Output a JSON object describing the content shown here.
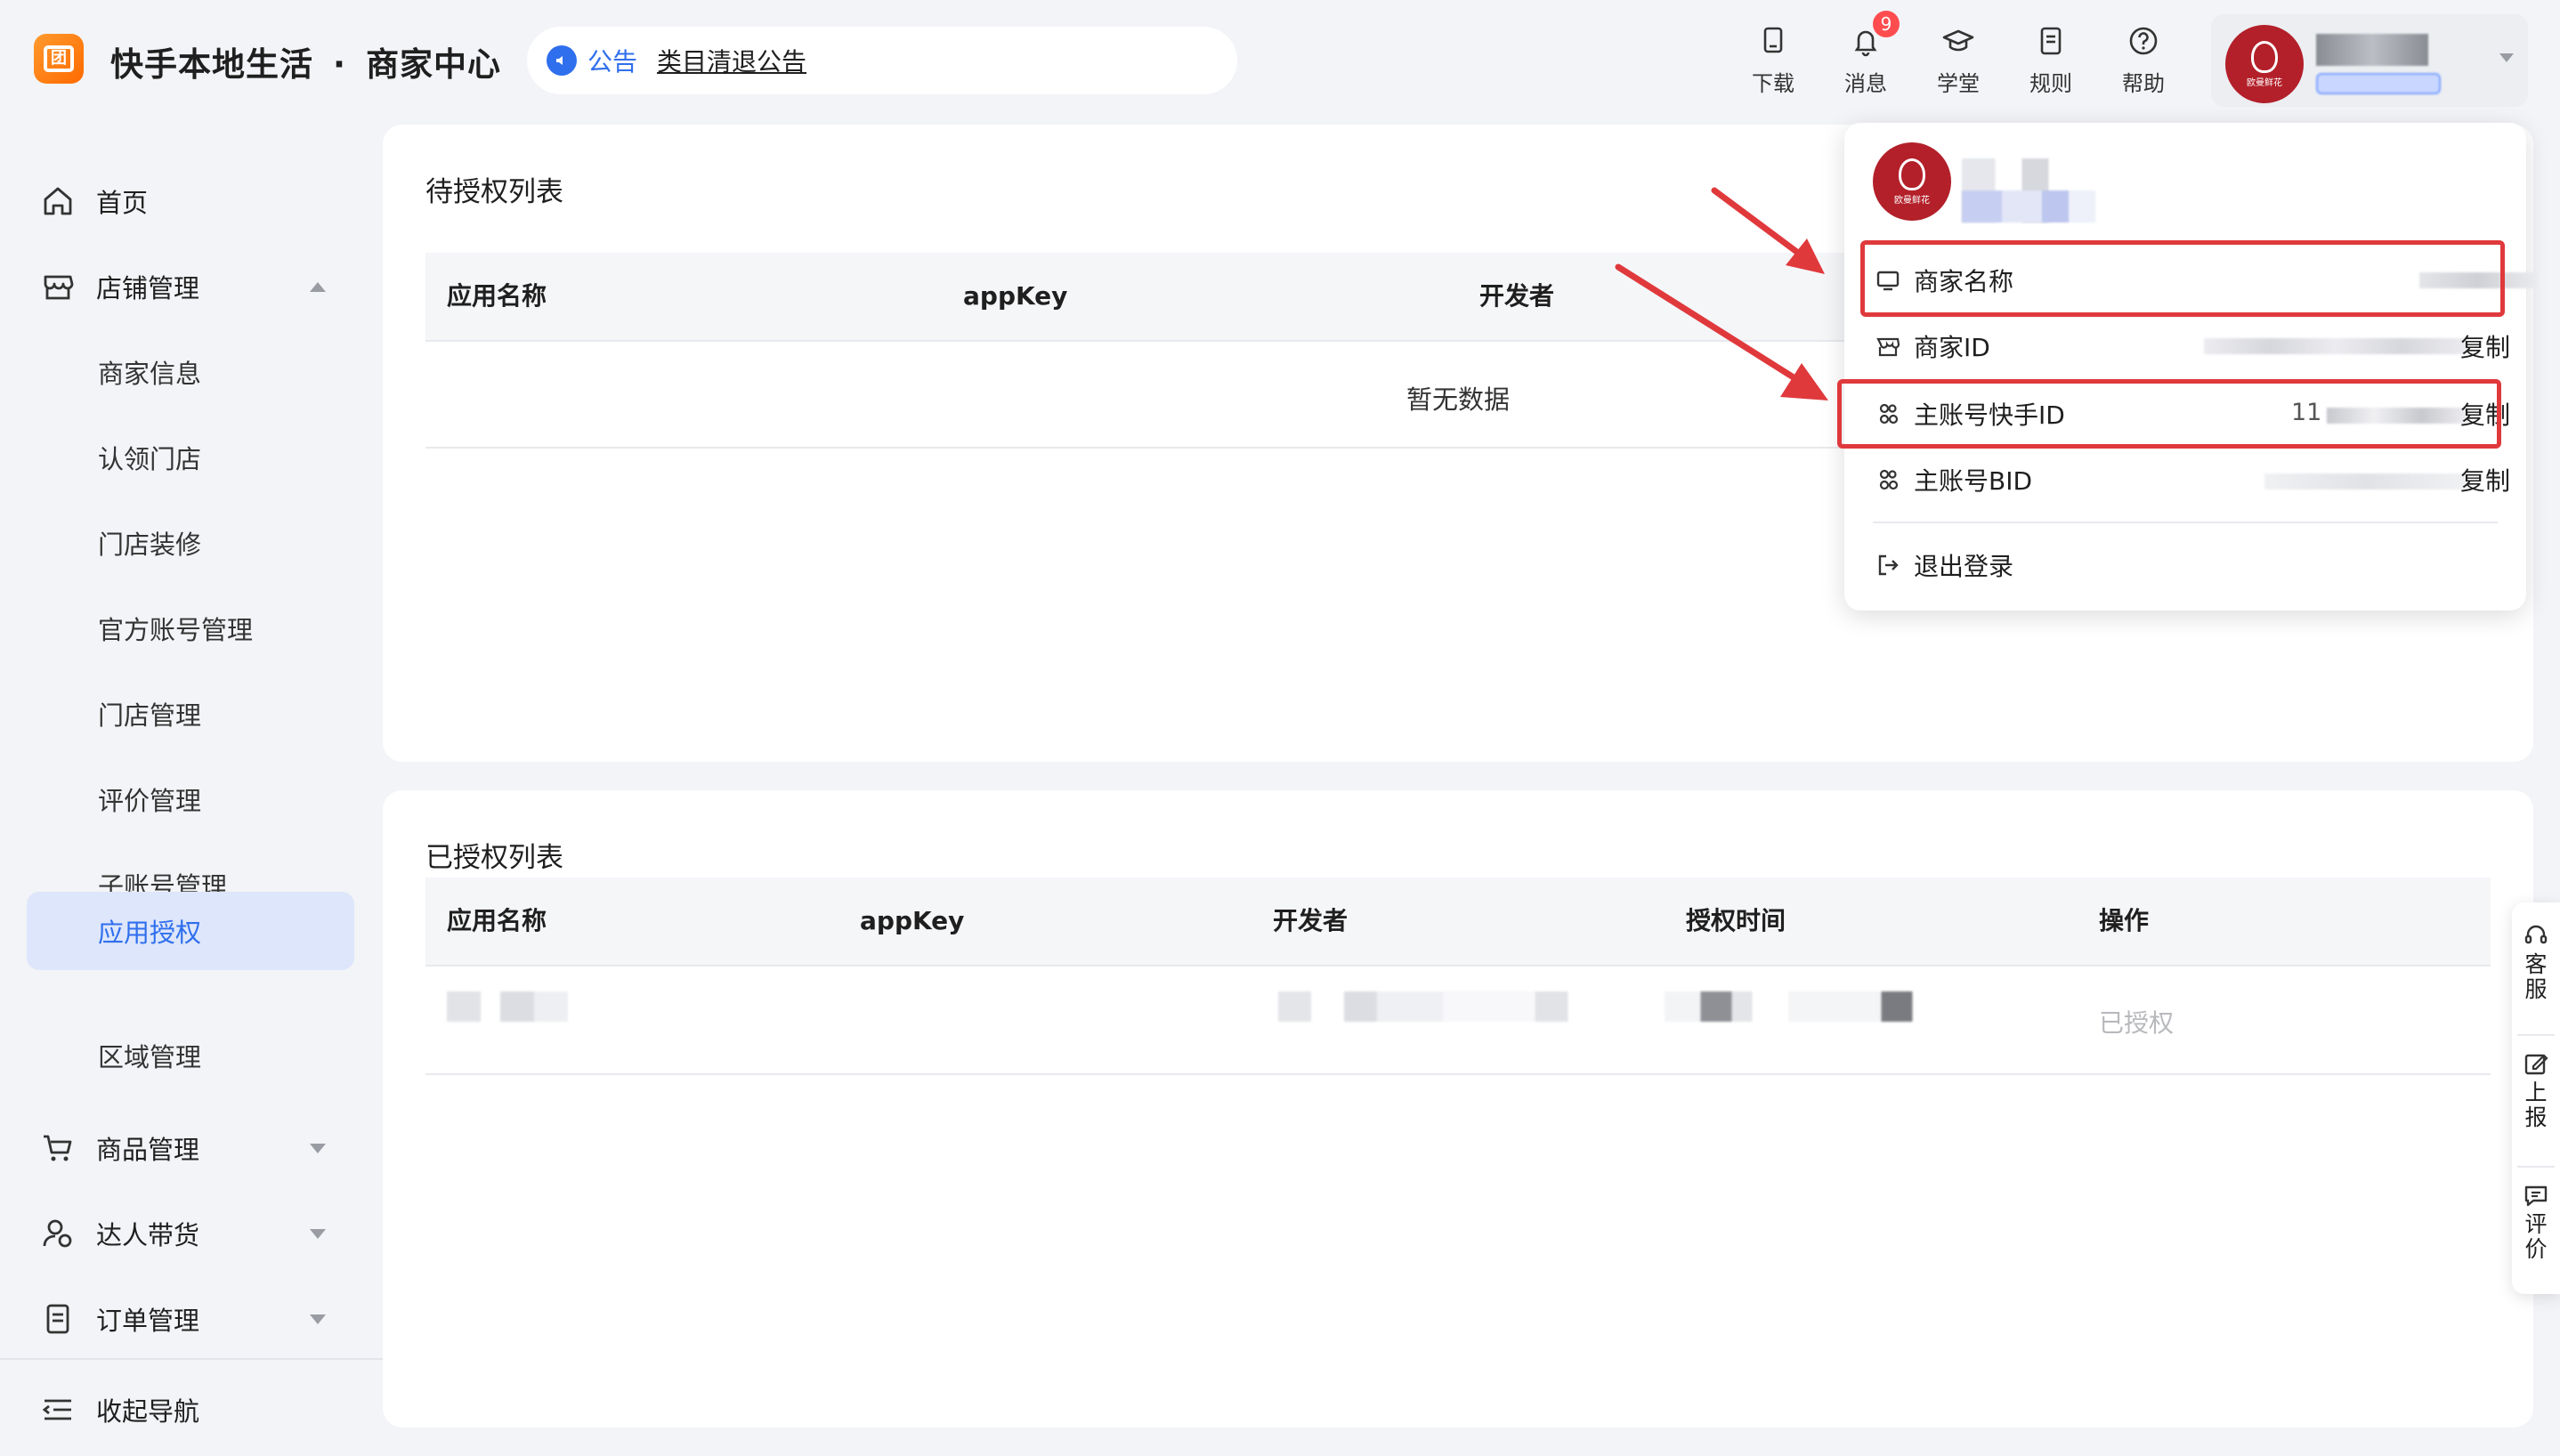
{
  "header": {
    "app_title": "快手本地生活",
    "app_subtitle": "商家中心",
    "notice_label": "公告",
    "notice_link": "类目清退公告",
    "tools": [
      {
        "label": "下载",
        "icon": "download-icon"
      },
      {
        "label": "消息",
        "icon": "bell-icon",
        "badge": "9"
      },
      {
        "label": "学堂",
        "icon": "graduation-cap-icon"
      },
      {
        "label": "规则",
        "icon": "document-icon"
      },
      {
        "label": "帮助",
        "icon": "help-circle-icon"
      }
    ]
  },
  "sidebar": {
    "items": [
      {
        "label": "首页",
        "icon": "home-icon"
      },
      {
        "label": "店铺管理",
        "icon": "store-icon",
        "expanded": true
      },
      {
        "label": "商家信息"
      },
      {
        "label": "认领门店"
      },
      {
        "label": "门店装修"
      },
      {
        "label": "官方账号管理"
      },
      {
        "label": "门店管理"
      },
      {
        "label": "评价管理"
      },
      {
        "label": "子账号管理"
      },
      {
        "label": "应用授权",
        "active": true
      },
      {
        "label": "区域管理"
      },
      {
        "label": "商品管理",
        "icon": "cart-icon"
      },
      {
        "label": "达人带货",
        "icon": "user-star-icon"
      },
      {
        "label": "订单管理",
        "icon": "order-icon"
      }
    ],
    "collapse_label": "收起导航"
  },
  "pending": {
    "title": "待授权列表",
    "columns": [
      "应用名称",
      "appKey",
      "开发者"
    ],
    "empty_text": "暂无数据"
  },
  "authorized": {
    "title": "已授权列表",
    "columns": [
      "应用名称",
      "appKey",
      "开发者",
      "授权时间",
      "操作"
    ],
    "rows": [
      {
        "status": "已授权"
      }
    ]
  },
  "account_menu": {
    "rows": [
      {
        "label": "商家名称",
        "icon": "monitor-icon"
      },
      {
        "label": "商家ID",
        "icon": "store-icon",
        "action": "复制"
      },
      {
        "label": "主账号快手ID",
        "icon": "users-icon",
        "value": "11",
        "action": "复制"
      },
      {
        "label": "主账号BID",
        "icon": "users-icon",
        "action": "复制"
      }
    ],
    "logout_label": "退出登录"
  },
  "floatbar": {
    "items": [
      {
        "label": "客服",
        "icon": "headset-icon"
      },
      {
        "label": "上报",
        "icon": "edit-icon"
      },
      {
        "label": "评价",
        "icon": "comment-icon"
      }
    ]
  },
  "colors": {
    "accent": "#2f6fed",
    "highlight": "#e0393c",
    "brand_avatar": "#b3202a"
  }
}
